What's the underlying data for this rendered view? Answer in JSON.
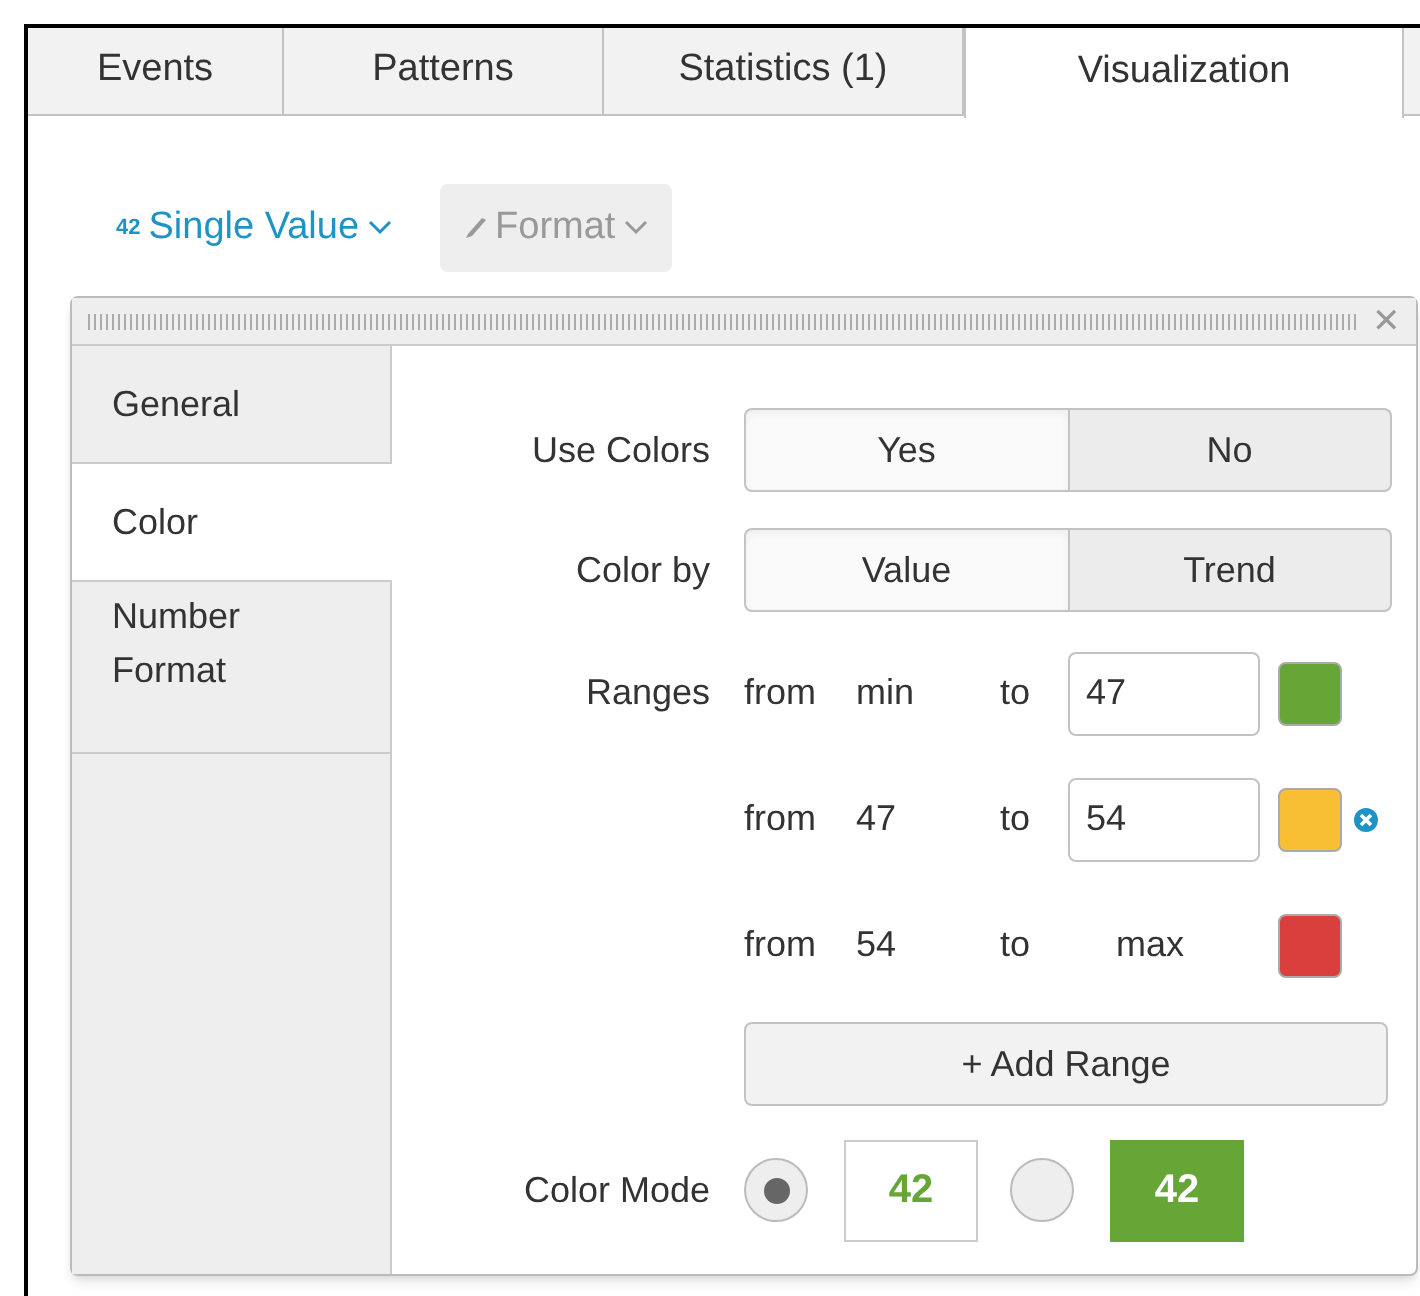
{
  "tabs": [
    {
      "label": "Events",
      "selected": false
    },
    {
      "label": "Patterns",
      "selected": false
    },
    {
      "label": "Statistics (1)",
      "selected": false
    },
    {
      "label": "Visualization",
      "selected": true
    }
  ],
  "toolbar": {
    "viz_badge": "42",
    "viz_label": "Single Value",
    "format_label": "Format"
  },
  "panel": {
    "close": "✕",
    "sidebar": [
      {
        "label": "General",
        "selected": false
      },
      {
        "label": "Color",
        "selected": true
      },
      {
        "label": "Number Format",
        "selected": false
      }
    ],
    "use_colors": {
      "label": "Use Colors",
      "options": [
        {
          "label": "Yes",
          "selected": true
        },
        {
          "label": "No",
          "selected": false
        }
      ]
    },
    "color_by": {
      "label": "Color by",
      "options": [
        {
          "label": "Value",
          "selected": true
        },
        {
          "label": "Trend",
          "selected": false
        }
      ]
    },
    "ranges_label": "Ranges",
    "ranges": [
      {
        "from": "from",
        "from_value": "min",
        "to": "to",
        "to_value": "47",
        "editable": true,
        "color": "#65a637",
        "removable": false
      },
      {
        "from": "from",
        "from_value": "47",
        "to": "to",
        "to_value": "54",
        "editable": true,
        "color": "#f8be34",
        "removable": true
      },
      {
        "from": "from",
        "from_value": "54",
        "to": "to",
        "to_value": "max",
        "editable": false,
        "color": "#d93f3c",
        "removable": false
      }
    ],
    "add_range": "+ Add Range",
    "color_mode": {
      "label": "Color Mode",
      "options": [
        {
          "kind": "plain",
          "value": "42",
          "selected": true
        },
        {
          "kind": "filled",
          "value": "42",
          "selected": false
        }
      ]
    }
  }
}
